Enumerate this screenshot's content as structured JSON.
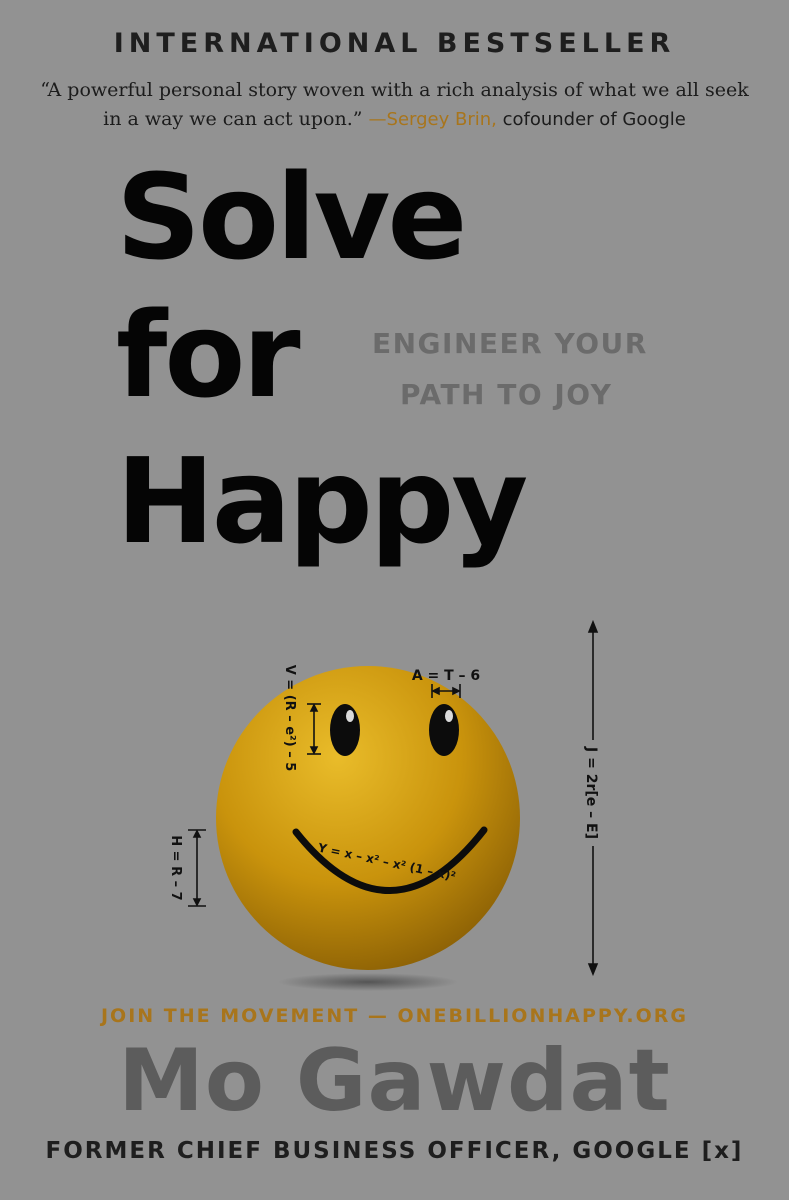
{
  "banner": "INTERNATIONAL BESTSELLER",
  "quote": {
    "text": "“A powerful personal story woven with a rich analysis of what we all seek in a way we can act upon.”",
    "attribution_name": "—Sergey Brin,",
    "attribution_role": "cofounder of Google"
  },
  "title": {
    "line1": "Solve",
    "line2": "for",
    "line3": "Happy"
  },
  "subtitle": {
    "line1": "ENGINEER YOUR",
    "line2": "PATH TO JOY"
  },
  "illustration": {
    "icon": "smiley-face-icon",
    "equations": {
      "eyebrow": "A = T – 6",
      "eye_height": "V = (R – e²) – 5",
      "smile": "Y = x – x² – x² (1 – x)²",
      "smile_offset": "H = R – 7",
      "face_height": "J = 2r[e – E]"
    }
  },
  "movement": "JOIN THE MOVEMENT — ONEBILLIONHAPPY.ORG",
  "author": "Mo Gawdat",
  "author_role": "FORMER CHIEF BUSINESS OFFICER, GOOGLE [x]",
  "colors": {
    "background": "#929292",
    "accent": "#a8751c",
    "title": "#050505",
    "subtitle": "#6b6b6b",
    "smiley": "#c9930c"
  }
}
